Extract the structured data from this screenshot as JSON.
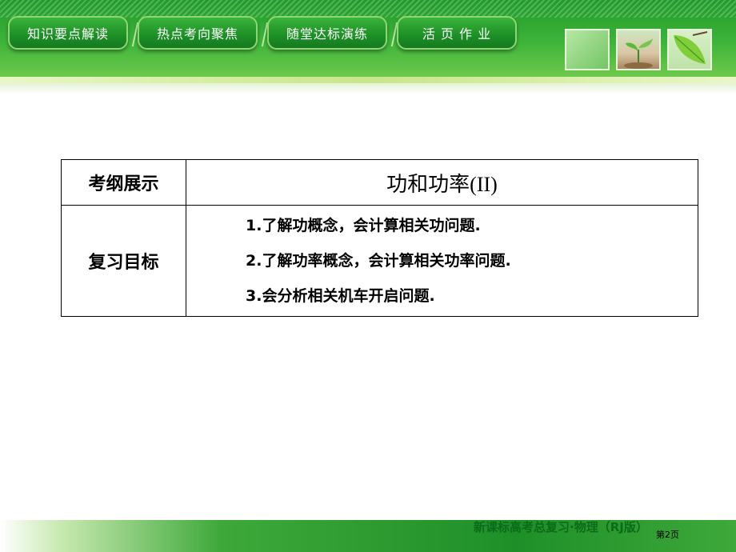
{
  "nav": {
    "tabs": [
      {
        "label": "知识要点解读"
      },
      {
        "label": "热点考向聚焦"
      },
      {
        "label": "随堂达标演练"
      },
      {
        "label": "活 页 作 业"
      }
    ]
  },
  "table": {
    "row1_label": "考纲展示",
    "topic": "功和功率(II)",
    "row2_label": "复习目标",
    "goals": [
      "1.了解功概念，会计算相关功问题.",
      "2.了解功率概念，会计算相关功率问题.",
      "3.会分析相关机车开启问题."
    ]
  },
  "footer": {
    "book_title": "新课标高考总复习·物理（RJ版）",
    "page_label": "第2页"
  }
}
